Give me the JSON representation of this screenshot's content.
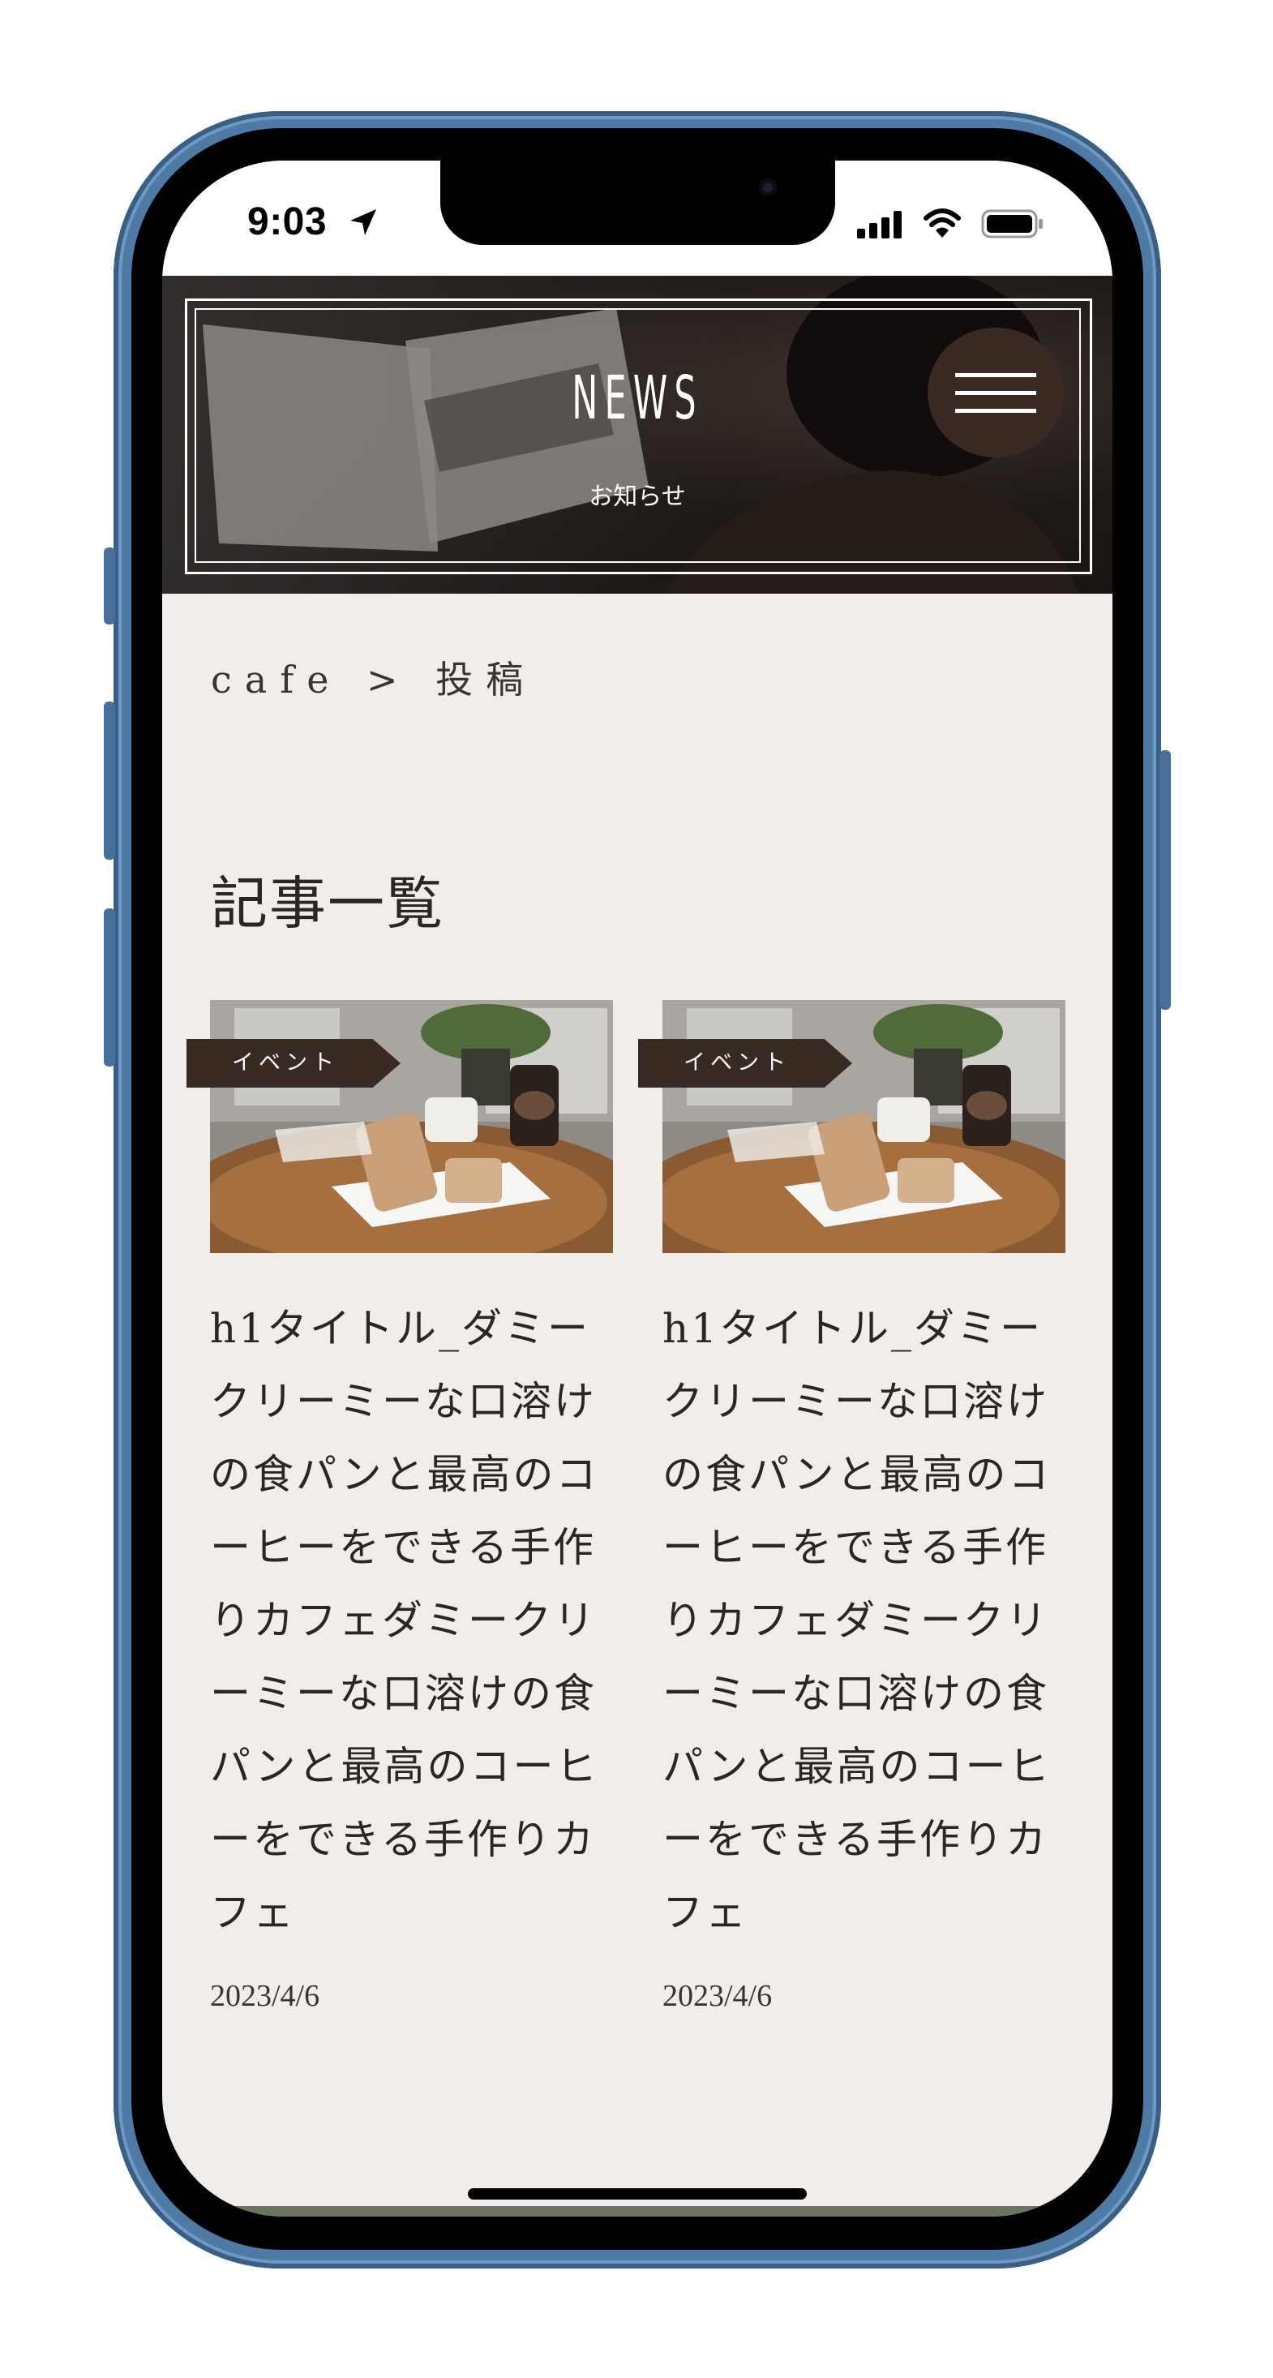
{
  "status_bar": {
    "time": "9:03"
  },
  "hero": {
    "title": "NEWS",
    "subtitle": "お知らせ"
  },
  "breadcrumb": {
    "text": "cafe > 投稿"
  },
  "section": {
    "title": "記事一覧"
  },
  "posts": [
    {
      "category": "イベント",
      "title": "h1タイトル_ダミークリーミーな口溶けの食パンと最高のコーヒーをできる手作りカフェダミークリーミーな口溶けの食パンと最高のコーヒーをできる手作りカフェ",
      "date": "2023/4/6"
    },
    {
      "category": "イベント",
      "title": "h1タイトル_ダミークリーミーな口溶けの食パンと最高のコーヒーをできる手作りカフェダミークリーミーな口溶けの食パンと最高のコーヒーをできる手作りカフェ",
      "date": "2023/4/6"
    }
  ],
  "colors": {
    "page_background": "#f0edea",
    "accent_dark_brown": "#3a2a24",
    "phone_frame_blue": "#4e7aa6"
  },
  "icons": [
    "location-arrow-icon",
    "signal-icon",
    "wifi-icon",
    "battery-icon",
    "hamburger-menu-icon"
  ]
}
